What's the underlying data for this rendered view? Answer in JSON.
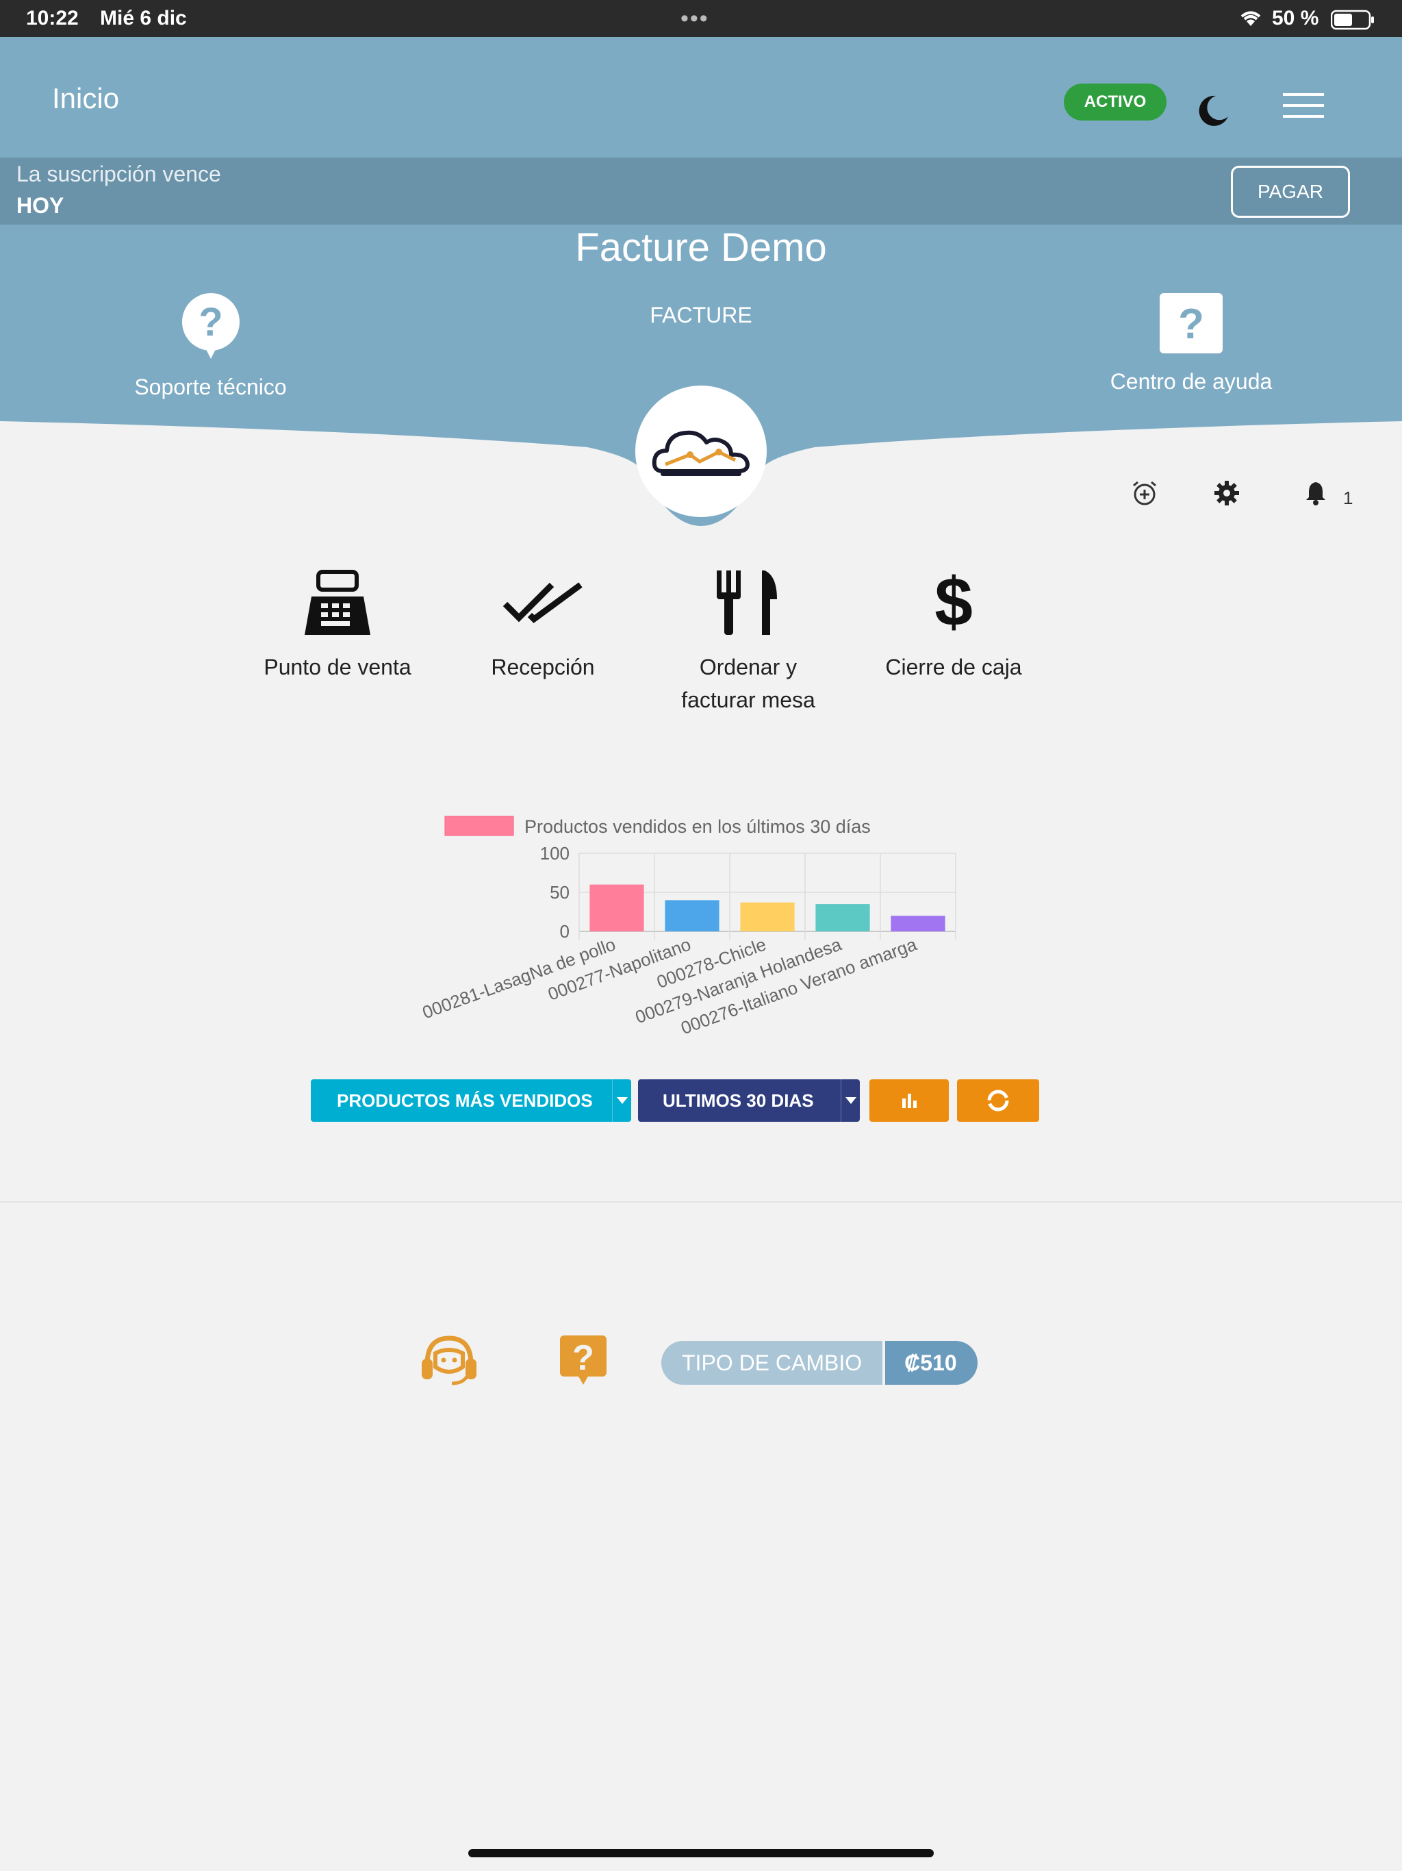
{
  "status_bar": {
    "time": "10:22",
    "date": "Mié 6 dic",
    "battery_pct": "50 %"
  },
  "header": {
    "title": "Inicio",
    "status_badge": "ACTIVO",
    "icons": [
      "moon-icon",
      "hamburger-menu-icon"
    ]
  },
  "subscription": {
    "message": "La suscripción vence",
    "when": "HOY",
    "pay_label": "PAGAR"
  },
  "company": {
    "name": "Facture Demo",
    "brand": "FACTURE",
    "support_label": "Soporte técnico",
    "help_label": "Centro de ayuda"
  },
  "utility": {
    "icons": [
      "alarm-add-icon",
      "gear-icon",
      "bell-icon"
    ],
    "notification_count": "1"
  },
  "shortcuts": [
    {
      "label": "Punto de venta",
      "icon": "cash-register-icon"
    },
    {
      "label": "Recepción",
      "icon": "double-check-icon"
    },
    {
      "label_line1": "Ordenar y",
      "label_line2": "facturar mesa",
      "icon": "fork-knife-icon"
    },
    {
      "label": "Cierre de caja",
      "icon": "dollar-icon"
    }
  ],
  "chart_data": {
    "type": "bar",
    "legend": "Productos vendidos en los últimos  30 días",
    "categories": [
      "000281-LasagNa de pollo",
      "000277-Napolitano",
      "000278-Chicle",
      "000279-Naranja Holandesa",
      "000276-Italiano Verano amarga"
    ],
    "values": [
      60,
      40,
      37,
      35,
      20
    ],
    "colors": [
      "#ff7f9a",
      "#4ea6ea",
      "#ffd060",
      "#5cc9c4",
      "#a175f2"
    ],
    "ylim": [
      0,
      100
    ],
    "yticks": [
      "100",
      "50",
      "0"
    ],
    "grid": true,
    "legend_position": "top"
  },
  "controls": {
    "report_select": "PRODUCTOS MÁS VENDIDOS",
    "period_select": "ULTIMOS 30 DIAS"
  },
  "footer": {
    "fx_label": "TIPO DE CAMBIO",
    "fx_value": "₡510"
  }
}
